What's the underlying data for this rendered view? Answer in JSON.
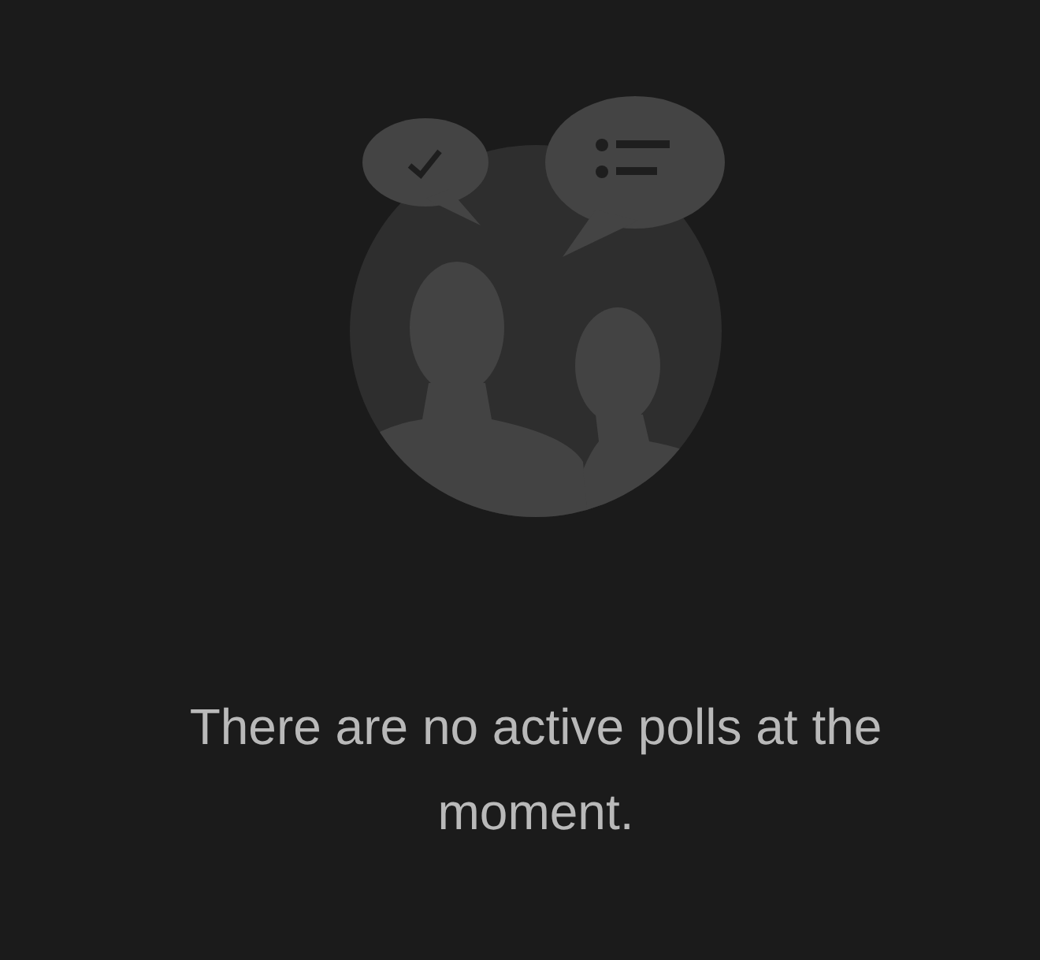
{
  "empty_state": {
    "message": "There are no active polls at the moment."
  }
}
